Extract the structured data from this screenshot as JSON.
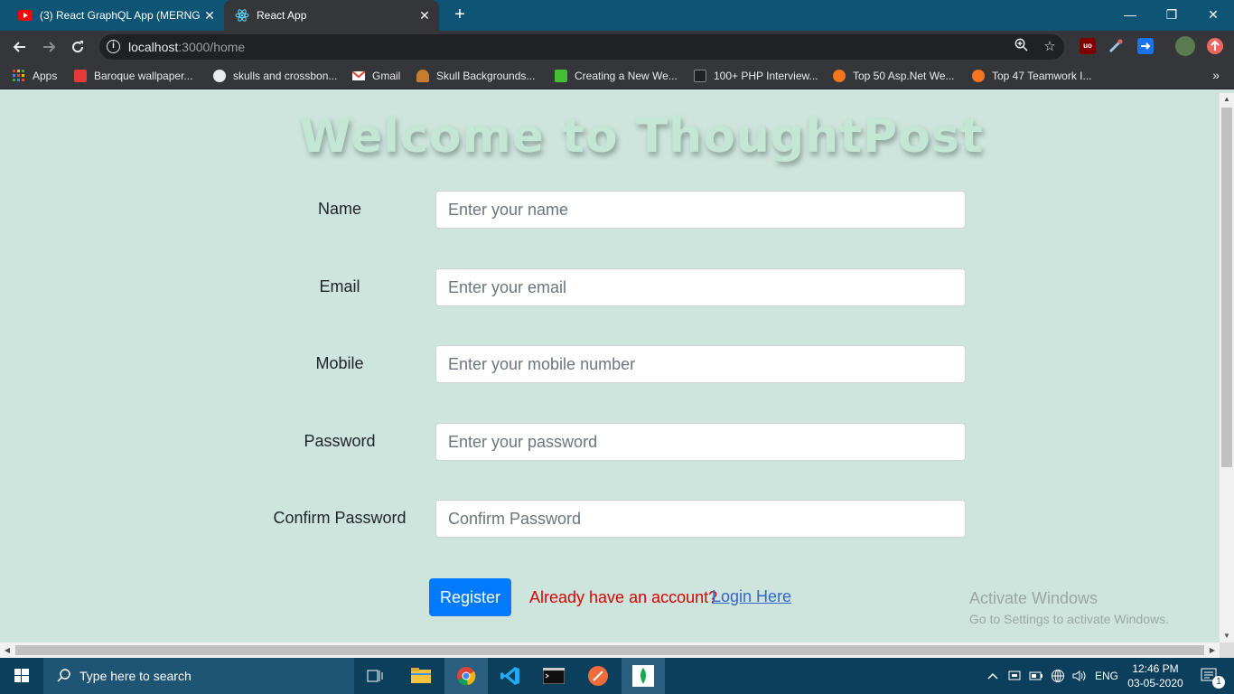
{
  "browser": {
    "tabs": [
      {
        "title": "(3) React GraphQL App (MERNG)",
        "favicon": "youtube-icon",
        "active": false
      },
      {
        "title": "React App",
        "favicon": "react-icon",
        "active": true
      }
    ],
    "tab_close_glyph": "✕",
    "new_tab_glyph": "+",
    "window_controls": {
      "minimize": "—",
      "restore": "❐",
      "close": "✕"
    },
    "url_host": "localhost",
    "url_path": ":3000/home",
    "bookmarks": [
      {
        "label": "Apps",
        "icon": "apps-grid-icon",
        "color": "#e94235"
      },
      {
        "label": "Baroque wallpaper...",
        "icon": "cart-icon",
        "color": "#e53935"
      },
      {
        "label": "skulls and crossbon...",
        "icon": "globe-icon",
        "color": "#e8eaed"
      },
      {
        "label": "Gmail",
        "icon": "gmail-icon",
        "color": "#ea4335"
      },
      {
        "label": "Skull Backgrounds...",
        "icon": "skull-icon",
        "color": "#c77d2e"
      },
      {
        "label": "Creating a New We...",
        "icon": "site-icon",
        "color": "#43c033"
      },
      {
        "label": "100+ PHP Interview...",
        "icon": "code-icon",
        "color": "#202124"
      },
      {
        "label": "Top 50 Asp.Net We...",
        "icon": "g-icon",
        "color": "#f4761d"
      },
      {
        "label": "Top 47 Teamwork I...",
        "icon": "g-icon",
        "color": "#f4761d"
      }
    ],
    "bookmarks_overflow": "»"
  },
  "page": {
    "heading": "Welcome to ThoughtPost",
    "fields": [
      {
        "label": "Name",
        "placeholder": "Enter your name",
        "type": "text"
      },
      {
        "label": "Email",
        "placeholder": "Enter your email",
        "type": "email"
      },
      {
        "label": "Mobile",
        "placeholder": "Enter your mobile number",
        "type": "text"
      },
      {
        "label": "Password",
        "placeholder": "Enter your password",
        "type": "password"
      },
      {
        "label": "Confirm Password",
        "placeholder": "Confirm Password",
        "type": "password"
      }
    ],
    "register_label": "Register",
    "already_text": "Already have an account?",
    "login_link": "Login Here",
    "colors": {
      "background": "#cde5dd",
      "button": "#007bff",
      "already": "#dc0000",
      "link": "#3366cc"
    }
  },
  "watermark": {
    "line1": "Activate Windows",
    "line2": "Go to Settings to activate Windows."
  },
  "taskbar": {
    "search_placeholder": "Type here to search",
    "apps": [
      "task-view-icon",
      "file-explorer-icon",
      "chrome-icon",
      "vscode-icon",
      "terminal-icon",
      "postman-icon",
      "mongodb-icon"
    ],
    "language": "ENG",
    "time": "12:46 PM",
    "date": "03-05-2020",
    "notification_count": "1"
  }
}
